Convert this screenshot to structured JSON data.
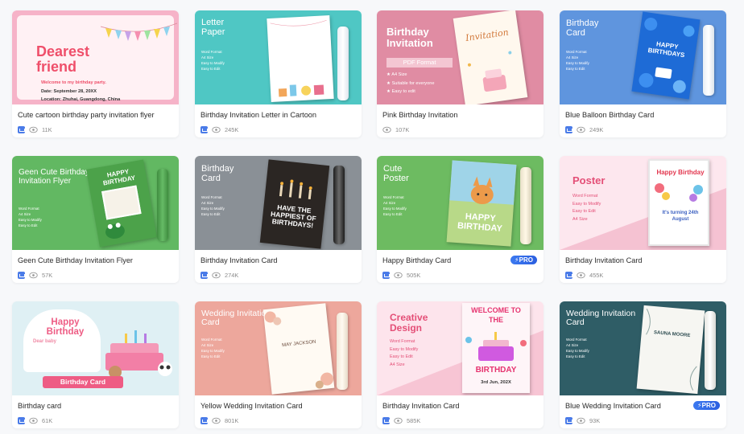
{
  "cards": [
    {
      "title": "Cute cartoon birthday party invitation flyer",
      "views": "11K",
      "pro": false,
      "thumb": {
        "heading": "Dearest friend",
        "line1": "Welcome to my birthday party.",
        "line2": "Date: September 28, 20XX",
        "line3": "Location: Zhuhai, Guangdong, China"
      }
    },
    {
      "title": "Birthday Invitation Letter in Cartoon",
      "views": "245K",
      "pro": false,
      "thumb": {
        "heading": "Letter Paper",
        "features": [
          "Word Format",
          "A4 Size",
          "Easy to Modify",
          "Easy to Edit"
        ]
      }
    },
    {
      "title": "Pink Birthday Invitation",
      "views": "107K",
      "pro": false,
      "thumb": {
        "heading": "Birthday Invitation",
        "format": "PDF Format",
        "features": [
          "★ A4 Size",
          "★ Suitable for everyone",
          "★ Easy to edit"
        ],
        "paper_text": "Invitation"
      }
    },
    {
      "title": "Blue Balloon Birthday Card",
      "views": "249K",
      "pro": false,
      "thumb": {
        "heading": "Birthday Card",
        "features": [
          "Word Format",
          "A4 Size",
          "Easy to Modify",
          "Easy to Edit"
        ],
        "paper_text": "HAPPY BIRTHDAYS"
      }
    },
    {
      "title": "Geen Cute Birthday Invitation Flyer",
      "views": "57K",
      "pro": false,
      "thumb": {
        "heading": "Geen Cute Birthday Invitation Flyer",
        "features": [
          "Word Format",
          "A4 Size",
          "Easy to Modify",
          "Easy to Edit"
        ],
        "paper_text": "HAPPY BIRTHDAY"
      }
    },
    {
      "title": "Birthday Invitation Card",
      "views": "274K",
      "pro": false,
      "thumb": {
        "heading": "Birthday Card",
        "features": [
          "Word Format",
          "A4 Size",
          "Easy to Modify",
          "Easy to Edit"
        ],
        "paper_text": "HAVE THE HAPPIEST OF BIRTHDAYS!"
      }
    },
    {
      "title": "Happy Birthday Card",
      "views": "505K",
      "pro": true,
      "pro_label": "PRO",
      "thumb": {
        "heading": "Cute Poster",
        "features": [
          "Word Format",
          "A4 Size",
          "Easy to Modify",
          "Easy to Edit"
        ],
        "paper_text": "HAPPY BIRTHDAY"
      }
    },
    {
      "title": "Birthday Invitation Card",
      "views": "455K",
      "pro": false,
      "thumb": {
        "heading": "Poster",
        "features": [
          "Word Format",
          "Easy to Modify",
          "Easy to Edit",
          "A4 Size"
        ],
        "paper_text": "Happy Birthday",
        "paper_text2": "It's turning 24th August"
      }
    },
    {
      "title": "Birthday card",
      "views": "61K",
      "pro": false,
      "thumb": {
        "heading": "Happy Birthday",
        "sub": "Dear baby",
        "banner": "Birthday Card"
      }
    },
    {
      "title": "Yellow Wedding Invitation Card",
      "views": "801K",
      "pro": false,
      "thumb": {
        "heading": "Wedding Invitation Card",
        "features": [
          "Word Format",
          "A4 Size",
          "Easy to Modify",
          "Easy to Edit"
        ],
        "paper_text": "MAY JACKSON"
      }
    },
    {
      "title": "Birthday Invitation Card",
      "views": "585K",
      "pro": false,
      "thumb": {
        "heading": "Creative Design",
        "features": [
          "Word Format",
          "Easy to Modify",
          "Easy to Edit",
          "A4 Size"
        ],
        "paper_text": "WELCOME TO THE",
        "paper_text2": "BIRTHDAY",
        "paper_text3": "3rd Jun, 202X"
      }
    },
    {
      "title": "Blue Wedding Invitation Card",
      "views": "93K",
      "pro": true,
      "pro_label": "PRO",
      "thumb": {
        "heading": "Wedding Invitation Card",
        "features": [
          "Word Format",
          "A4 Size",
          "Easy to Modify",
          "Easy to Edit"
        ],
        "paper_text": "SAUNA MOORE"
      }
    }
  ],
  "colors": {
    "bg": "#f7f8fa",
    "accent": "#3c79f0",
    "text": "#2b2b2b",
    "meta": "#8a8a8a"
  },
  "icons": {
    "type": "document-icon",
    "views": "eye-icon",
    "pro": "lightning-icon"
  }
}
